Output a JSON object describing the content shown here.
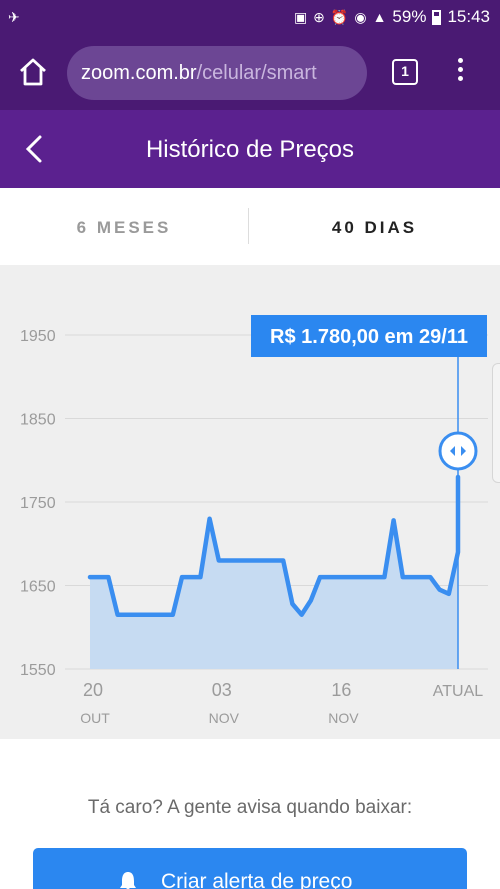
{
  "status_bar": {
    "left_icons": "✈",
    "battery": "59%",
    "time": "15:43"
  },
  "browser": {
    "url_host": "zoom.com.br",
    "url_path": "/celular/smart",
    "tab_count": "1"
  },
  "header": {
    "title": "Histórico de Preços"
  },
  "tabs": [
    {
      "label": "6 MESES",
      "selected": false
    },
    {
      "label": "40 DIAS",
      "selected": true
    }
  ],
  "chart_data": {
    "type": "area",
    "y_ticks": [
      "1950",
      "1850",
      "1750",
      "1650",
      "1550"
    ],
    "ylim": [
      1550,
      1950
    ],
    "x_ticks": [
      {
        "label": "20",
        "sub": "OUT",
        "day_index": 0
      },
      {
        "label": "03",
        "sub": "NOV",
        "day_index": 14
      },
      {
        "label": "16",
        "sub": "NOV",
        "day_index": 27
      },
      {
        "label": "ATUAL",
        "sub": "",
        "day_index": 40
      }
    ],
    "x": [
      0,
      2,
      3,
      9,
      10,
      12,
      13,
      14,
      15,
      21,
      22,
      23,
      24,
      25,
      26,
      32,
      33,
      34,
      37,
      38,
      39,
      40
    ],
    "y": [
      1660,
      1660,
      1615,
      1615,
      1660,
      1660,
      1730,
      1680,
      1680,
      1680,
      1628,
      1615,
      1632,
      1660,
      1660,
      1660,
      1728,
      1660,
      1660,
      1645,
      1640,
      1690
    ],
    "end_value": 1780,
    "tooltip": "R$ 1.780,00 em 29/11",
    "line_color": "#3a8ef0",
    "fill_color": "#c6dbf2",
    "grid": true
  },
  "alert": {
    "prompt": "Tá caro? A gente avisa quando baixar:",
    "button_label": "Criar alerta de preço"
  }
}
